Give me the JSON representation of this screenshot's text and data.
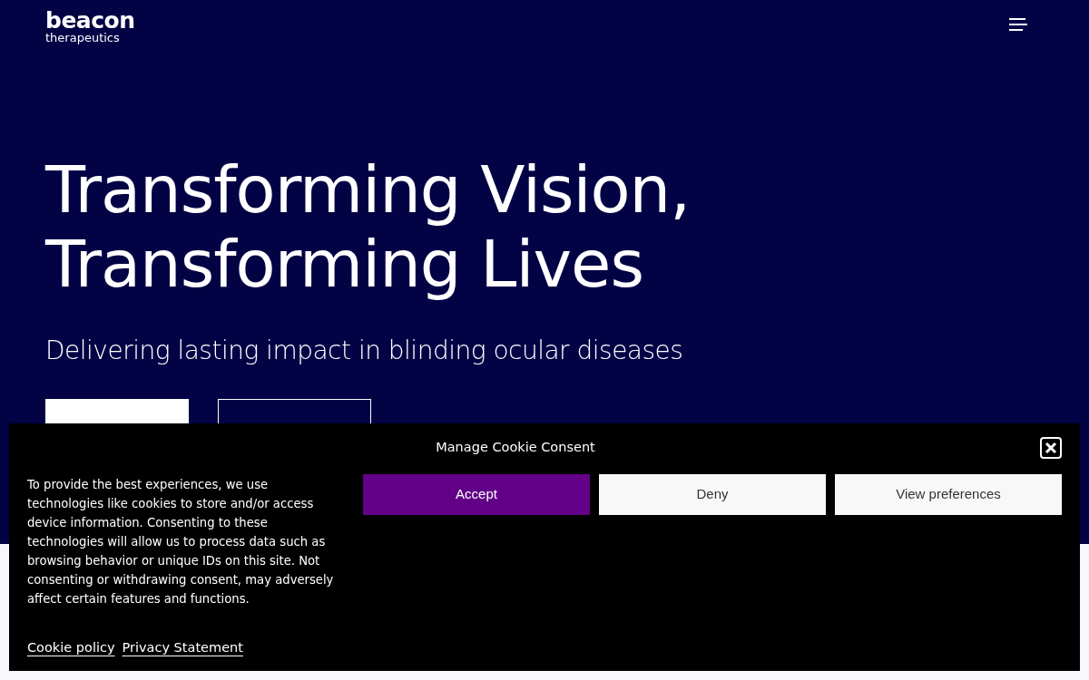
{
  "header": {
    "logo_word": "beacon",
    "logo_sub": "therapeutics"
  },
  "hero": {
    "title_lines": [
      "Transforming Vision,",
      "Transforming Lives"
    ],
    "subtitle": "Delivering lasting impact in blinding ocular diseases",
    "buttons": [
      {
        "kind": "solid"
      },
      {
        "kind": "outline"
      }
    ]
  },
  "cookie_banner": {
    "title": "Manage Cookie Consent",
    "message": "To provide the best experiences, we use technologies like cookies to store and/or access device information. Consenting to these technologies will allow us to process data such as browsing behavior or unique IDs on this site. Not consenting or withdrawing consent, may adversely affect certain features and functions.",
    "buttons": [
      {
        "label": "Accept",
        "kind": "primary"
      },
      {
        "label": "Deny",
        "kind": "secondary"
      },
      {
        "label": "View preferences",
        "kind": "secondary"
      }
    ],
    "links": [
      "Cookie policy",
      "Privacy Statement"
    ]
  }
}
